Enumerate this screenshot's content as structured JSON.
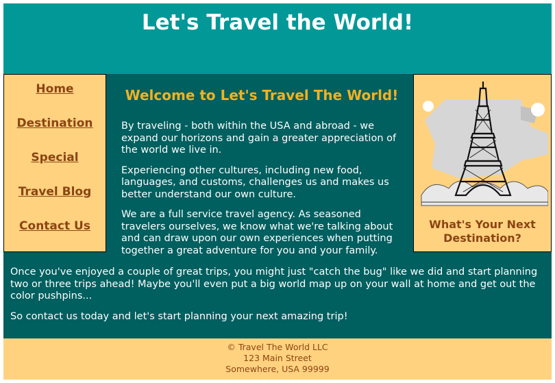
{
  "header": {
    "title": "Let's Travel the World!"
  },
  "nav": {
    "items": [
      {
        "label": "Home"
      },
      {
        "label": "Destination"
      },
      {
        "label": "Special"
      },
      {
        "label": "Travel Blog"
      },
      {
        "label": "Contact Us"
      }
    ]
  },
  "main": {
    "heading": "Welcome to Let's Travel The World!",
    "paragraphs": [
      "By traveling - both within the USA and abroad - we expand our horizons and gain a greater appreciation of the world we live in.",
      "Experiencing other cultures, including new food, languages, and customs, challenges us and makes us better understand our own culture.",
      "We are a full service travel agency. As seasoned travelers ourselves, we know what we're talking about and can draw upon our own experiences when putting together a great adventure for you and your family."
    ],
    "lower_paragraphs": [
      "Once you've enjoyed a couple of great trips, you might just \"catch the bug\" like we did and start planning two or three trips ahead! Maybe you'll even put a big world map up on your wall at home and get out the color pushpins...",
      "So contact us today and let's start planning your next amazing trip!"
    ]
  },
  "aside": {
    "image": "eiffel-tower-illustration",
    "caption_line1": "What's Your Next",
    "caption_line2": "Destination?"
  },
  "footer": {
    "line1": "© Travel The World LLC",
    "line2": "123 Main Street",
    "line3": "Somewhere, USA 99999"
  },
  "colors": {
    "header_bg": "#029898",
    "body_bg": "#005f5f",
    "panel_bg": "#ffd280",
    "link": "#8b4513",
    "heading": "#f4b11e"
  }
}
